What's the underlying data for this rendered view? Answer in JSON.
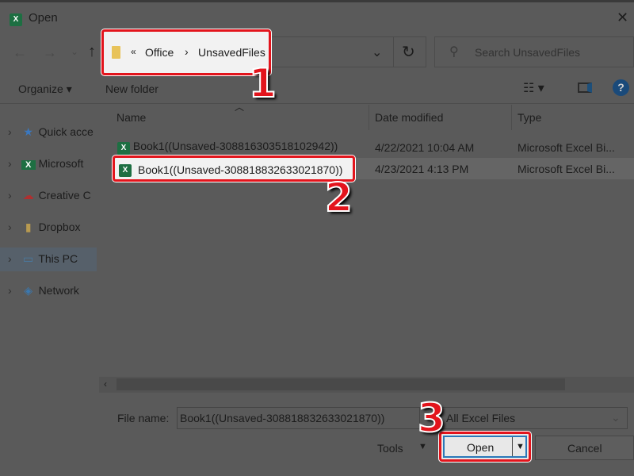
{
  "window": {
    "title": "Open",
    "close": "✕"
  },
  "address": {
    "overflow": "«",
    "crumbs": [
      "Office",
      "UnsavedFiles"
    ],
    "sep": "›"
  },
  "search": {
    "placeholder": "Search UnsavedFiles"
  },
  "toolbar": {
    "organize": "Organize ▾",
    "new_folder": "New folder",
    "help": "?"
  },
  "sidebar": {
    "items": [
      {
        "label": "Quick acce",
        "icon": "star-icon"
      },
      {
        "label": "Microsoft",
        "icon": "excel-icon"
      },
      {
        "label": "Creative C",
        "icon": "creative-cloud-icon"
      },
      {
        "label": "Dropbox",
        "icon": "folder-icon"
      },
      {
        "label": "This PC",
        "icon": "computer-icon",
        "selected": true
      },
      {
        "label": "Network",
        "icon": "network-icon"
      }
    ]
  },
  "columns": [
    "Name",
    "Date modified",
    "Type"
  ],
  "files": [
    {
      "name": "Book1((Unsaved-308816303518102942))",
      "date": "4/22/2021 10:04 AM",
      "type": "Microsoft Excel Bi..."
    },
    {
      "name": "Book1((Unsaved-308818832633021870))",
      "date": "4/23/2021 4:13 PM",
      "type": "Microsoft Excel Bi...",
      "selected": true
    }
  ],
  "footer": {
    "file_name_label": "File name:",
    "file_name_value": "Book1((Unsaved-308818832633021870))",
    "filter": "All Excel Files",
    "tools": "Tools",
    "open": "Open",
    "cancel": "Cancel"
  },
  "annotations": [
    "1",
    "2",
    "3"
  ],
  "colors": {
    "highlight_border": "#e3141c",
    "overlay_bg": "#5a5a5a"
  }
}
